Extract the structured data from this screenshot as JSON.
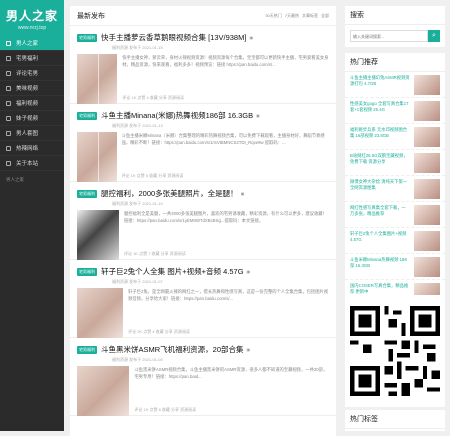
{
  "brand": {
    "name": "男人之家",
    "url": "www.nrzj.top"
  },
  "nav": [
    {
      "label": "男人之家",
      "active": true
    },
    {
      "label": "宅男福利"
    },
    {
      "label": "评论宅男"
    },
    {
      "label": "美味视频"
    },
    {
      "label": "福利视频"
    },
    {
      "label": "妹子视频"
    },
    {
      "label": "男人套图"
    },
    {
      "label": "热辣网络"
    },
    {
      "label": "关于本站"
    }
  ],
  "sidebar_footer": "男人之家",
  "main": {
    "title": "最新发布",
    "tabs": [
      "30天热门",
      "7天最热",
      "文章标签",
      "全部"
    ],
    "posts": [
      {
        "badge": "宅男福利",
        "title": "快手主播萝云香草鹅眼视频合集 [13V/938M]",
        "meta": "福利资源  发布于 2021-01-15",
        "excerpt": "快手主播女神，萝云草，身材火辣视频资源！视频资源每个合集，宝宝都可以更新快手主播，宅男爱看美女身材，精品资源，快来观看，福利多多！视频预览：链接 https://pan.baidu.com/s/...",
        "foot": "评论 1K   点赞 4  收藏  分享  资源阅读"
      },
      {
        "badge": "宅男福利",
        "title": "斗鱼主播Minana(米娜)热舞视频186部 16.3GB",
        "meta": "福利资源  发布于 2021-01-13",
        "excerpt": "斗鱼主播米娜Minana（米娜）合集整理的精彩热舞视频合集，可以免费下载观看，主播身材好，舞蹈节奏感强，精彩不断！链接：https://pan.baidu.com/s/1rSVtBMNCS2TDt_Rqxe9w 提取码：...",
        "foot": "评论 1K   点赞 5  收藏  分享  资源阅读"
      },
      {
        "badge": "宅男福利",
        "title": "腿控福利，2000多张美腿照片，全是腿！",
        "meta": "福利资源  发布于 2021-01-10",
        "excerpt": "腿控福利全是美腿，一共2000多张美腿图片，喜欢的宅男请收藏，精彩资源，有什么可以更多，建议收藏！链接：https://pan.baidu.com/s/1yEMtIWTdXBcBSg...提取码：本文链接。",
        "foot": "评论 1K   点赞 7  收藏  分享  资源阅读"
      },
      {
        "badge": "宅男福利",
        "title": "轩子巨2兔个人全集 图片+视频+音频 4.57G",
        "meta": "福利资源  发布于 2021-01-07",
        "excerpt": "轩子巨2兔，是全网最火辣的网红之一，擅长热舞和性感写真，这是一份完整的个人全集合集，包括图片视频音频，分享给大家！链接：https://pan.baidu.com/s/...",
        "foot": "评论 2K   点赞 4  收藏  分享  资源阅读"
      },
      {
        "badge": "宅男福利",
        "title": "斗鱼黑米饼ASMR飞机福利资源，20部合集",
        "meta": "福利资源  发布于 2021-01-05",
        "excerpt": "斗鱼黑米饼ASMR视频合集，斗鱼主播黑米饼的ASMR资源，很多人都不知道的宝藏视频，一共20部，宅男专用！链接：https://pan.baid...",
        "foot": "评论 1K   点赞 6  收藏  分享  资源阅读"
      }
    ]
  },
  "right": {
    "search_title": "搜索",
    "search_placeholder": "输入关键词搜索...",
    "hot_title": "热门推荐",
    "hot": [
      "斗鱼主播主播幻兔ASMR视频资源打包 4.7GB",
      "性感美女gogo 全套写真合集17套+1套视频 25.4G",
      "福利姬步兵系 无水印视频图合集 16部视频 23.8GB",
      "B站网红26.5G双鹅宝藏视频，免费下载 资源分享",
      "微博女神大杂烩 清纯天下第一 全网资源图集",
      "网红性感写真集全套下载，一万多张，精品推荐",
      "轩子巨2兔个人全集图片+视频 4.57G",
      "斗鱼米娜Minana热舞视频 186部 16.3GB",
      "国内COSER写真合集，精品推荐 更新中"
    ],
    "tags_title": "热门标签"
  }
}
